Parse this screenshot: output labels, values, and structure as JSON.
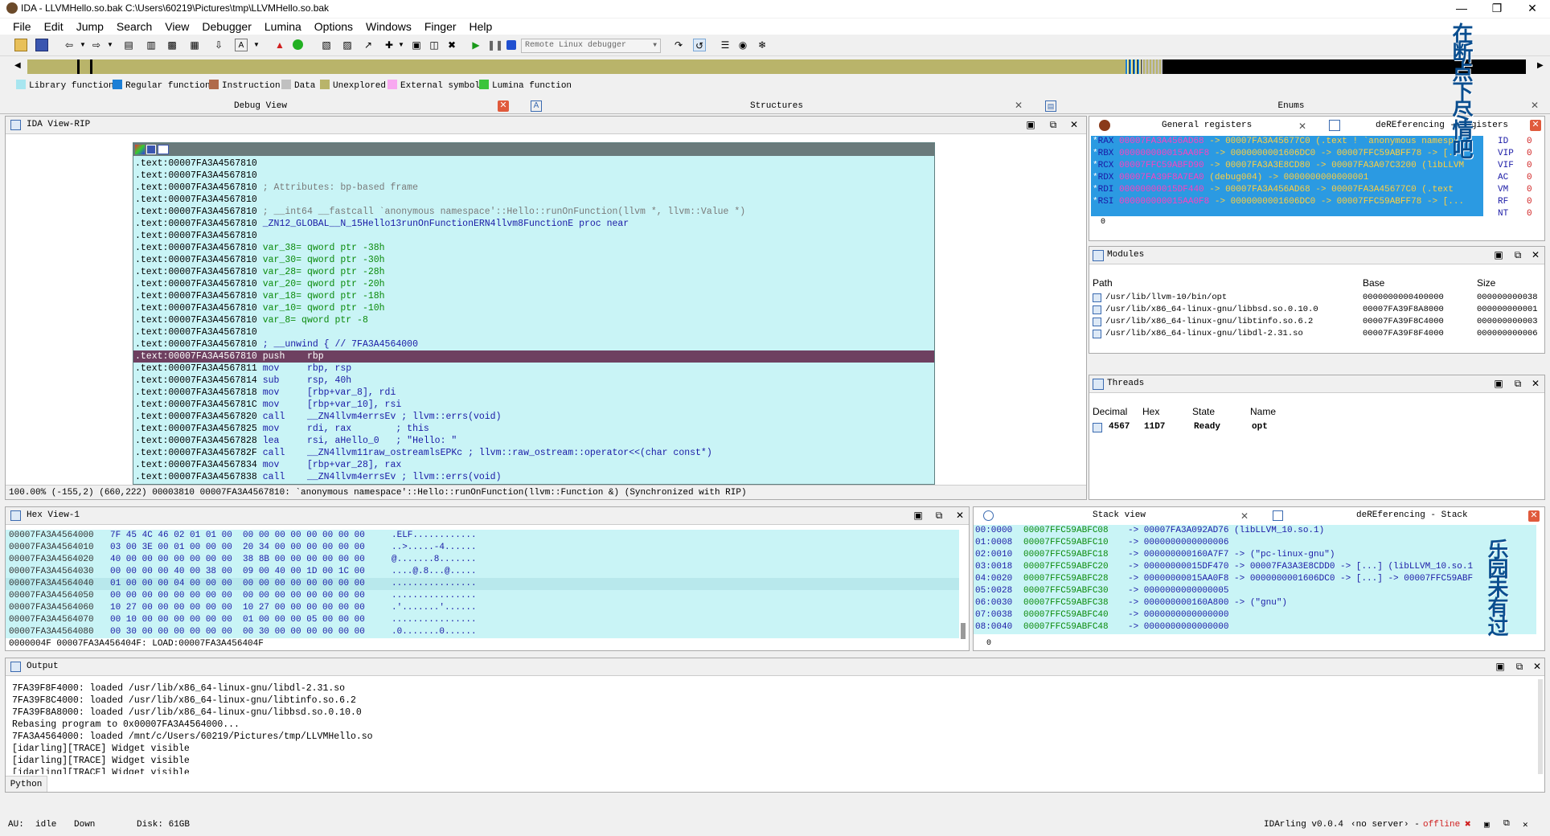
{
  "title": "IDA - LLVMHello.so.bak C:\\Users\\60219\\Pictures\\tmp\\LLVMHello.so.bak",
  "menu": [
    "File",
    "Edit",
    "Jump",
    "Search",
    "View",
    "Debugger",
    "Lumina",
    "Options",
    "Windows",
    "Finger",
    "Help"
  ],
  "debugger_select": "Remote Linux debugger",
  "legend": [
    {
      "label": "Library function",
      "color": "#a8e6f0"
    },
    {
      "label": "Regular function",
      "color": "#1c7fd6"
    },
    {
      "label": "Instruction",
      "color": "#b06a4a"
    },
    {
      "label": "Data",
      "color": "#c0c0c0"
    },
    {
      "label": "Unexplored",
      "color": "#b9b46a"
    },
    {
      "label": "External symbol",
      "color": "#f8a8f0"
    },
    {
      "label": "Lumina function",
      "color": "#3cc43c"
    }
  ],
  "tabs": {
    "debug_view": "Debug View",
    "structures": "Structures",
    "enums": "Enums"
  },
  "ida_view": {
    "title": "IDA View-RIP",
    "lines": [
      {
        "addr": ".text:00007FA3A4567810",
        "txt": ""
      },
      {
        "addr": ".text:00007FA3A4567810",
        "txt": ""
      },
      {
        "addr": ".text:00007FA3A4567810",
        "txt": "; Attributes: bp-based frame",
        "cls": "gry"
      },
      {
        "addr": ".text:00007FA3A4567810",
        "txt": ""
      },
      {
        "addr": ".text:00007FA3A4567810",
        "txt": "; __int64 __fastcall `anonymous namespace'::Hello::runOnFunction(llvm *, llvm::Value *)",
        "cls": "gry"
      },
      {
        "addr": ".text:00007FA3A4567810",
        "txt": "_ZN12_GLOBAL__N_15Hello13runOnFunctionERN4llvm8FunctionE proc near",
        "cls": "blu"
      },
      {
        "addr": ".text:00007FA3A4567810",
        "txt": ""
      },
      {
        "addr": ".text:00007FA3A4567810",
        "txt": "var_38= qword ptr -38h",
        "cls": "grn"
      },
      {
        "addr": ".text:00007FA3A4567810",
        "txt": "var_30= qword ptr -30h",
        "cls": "grn"
      },
      {
        "addr": ".text:00007FA3A4567810",
        "txt": "var_28= qword ptr -28h",
        "cls": "grn"
      },
      {
        "addr": ".text:00007FA3A4567810",
        "txt": "var_20= qword ptr -20h",
        "cls": "grn"
      },
      {
        "addr": ".text:00007FA3A4567810",
        "txt": "var_18= qword ptr -18h",
        "cls": "grn"
      },
      {
        "addr": ".text:00007FA3A4567810",
        "txt": "var_10= qword ptr -10h",
        "cls": "grn"
      },
      {
        "addr": ".text:00007FA3A4567810",
        "txt": "var_8= qword ptr -8",
        "cls": "grn"
      },
      {
        "addr": ".text:00007FA3A4567810",
        "txt": ""
      },
      {
        "addr": ".text:00007FA3A4567810",
        "txt": "; __unwind { // 7FA3A4564000",
        "cls": "blu"
      },
      {
        "addr": ".text:00007FA3A4567810",
        "txt": "push    rbp",
        "hl": true
      },
      {
        "addr": ".text:00007FA3A4567811",
        "txt": "mov     rbp, rsp",
        "cls": "blu"
      },
      {
        "addr": ".text:00007FA3A4567814",
        "txt": "sub     rsp, 40h",
        "cls": "blu"
      },
      {
        "addr": ".text:00007FA3A4567818",
        "txt": "mov     [rbp+var_8], rdi",
        "cls": "blu"
      },
      {
        "addr": ".text:00007FA3A456781C",
        "txt": "mov     [rbp+var_10], rsi",
        "cls": "blu"
      },
      {
        "addr": ".text:00007FA3A4567820",
        "txt": "call    __ZN4llvm4errsEv ; llvm::errs(void)",
        "cls": "blu"
      },
      {
        "addr": ".text:00007FA3A4567825",
        "txt": "mov     rdi, rax        ; this",
        "cls": "blu"
      },
      {
        "addr": ".text:00007FA3A4567828",
        "txt": "lea     rsi, aHello_0   ; \"Hello: \"",
        "cls": "blu"
      },
      {
        "addr": ".text:00007FA3A456782F",
        "txt": "call    __ZN4llvm11raw_ostreamlsEPKc ; llvm::raw_ostream::operator<<(char const*)",
        "cls": "blu"
      },
      {
        "addr": ".text:00007FA3A4567834",
        "txt": "mov     [rbp+var_28], rax",
        "cls": "blu"
      },
      {
        "addr": ".text:00007FA3A4567838",
        "txt": "call    __ZN4llvm4errsEv ; llvm::errs(void)",
        "cls": "blu"
      }
    ],
    "status": "100.00% (-155,2) (660,222) 00003810 00007FA3A4567810: `anonymous namespace'::Hello::runOnFunction(llvm::Function &) (Synchronized with RIP)"
  },
  "gen_regs": {
    "title": "General registers",
    "title2": "deREferencing - Registers",
    "rows": [
      {
        "name": "RAX",
        "val": "00007FA3A456AD68",
        "arrow": "-> 00007FA3A45677C0 (.text ! `anonymous namespa"
      },
      {
        "name": "RBX",
        "val": "000000000015AA0F8",
        "arrow": "-> 0000000001606DC0 -> 00007FFC59ABFF78 -> [..."
      },
      {
        "name": "RCX",
        "val": "00007FFC59ABFD90",
        "arrow": "-> 00007FA3A3E8CD80 -> 00007FA3A07C3200 (libLLVM"
      },
      {
        "name": "RDX",
        "val": "00007FA39F8A7EA0",
        "arrow": "(debug004) -> 0000000000000001"
      },
      {
        "name": "RDI",
        "val": "00000000015DF440",
        "arrow": "-> 00007FA3A456AD68 -> 00007FA3A45677C0 (.text"
      },
      {
        "name": "RSI",
        "val": "000000000015AA0F8",
        "arrow": "-> 0000000001606DC0 -> 00007FFC59ABFF78 -> [..."
      }
    ],
    "flags": [
      {
        "n": "ID",
        "v": "0"
      },
      {
        "n": "VIP",
        "v": "0"
      },
      {
        "n": "VIF",
        "v": "0"
      },
      {
        "n": "AC",
        "v": "0"
      },
      {
        "n": "VM",
        "v": "0"
      },
      {
        "n": "RF",
        "v": "0"
      },
      {
        "n": "NT",
        "v": "0"
      }
    ],
    "bottom": "0"
  },
  "modules": {
    "title": "Modules",
    "cols": [
      "Path",
      "Base",
      "Size"
    ],
    "rows": [
      {
        "path": "/usr/lib/llvm-10/bin/opt",
        "base": "0000000000400000",
        "size": "000000000038"
      },
      {
        "path": "/usr/lib/x86_64-linux-gnu/libbsd.so.0.10.0",
        "base": "00007FA39F8A8000",
        "size": "000000000001"
      },
      {
        "path": "/usr/lib/x86_64-linux-gnu/libtinfo.so.6.2",
        "base": "00007FA39F8C4000",
        "size": "000000000003"
      },
      {
        "path": "/usr/lib/x86_64-linux-gnu/libdl-2.31.so",
        "base": "00007FA39F8F4000",
        "size": "000000000006"
      }
    ]
  },
  "threads": {
    "title": "Threads",
    "cols": [
      "Decimal",
      "Hex",
      "State",
      "Name"
    ],
    "rows": [
      {
        "dec": "4567",
        "hex": "11D7",
        "state": "Ready",
        "name": "opt"
      }
    ]
  },
  "hex_view": {
    "title": "Hex View-1",
    "rows": [
      {
        "a": "00007FA3A4564000",
        "h": "7F 45 4C 46 02 01 01 00  00 00 00 00 00 00 00 00",
        "s": ".ELF............"
      },
      {
        "a": "00007FA3A4564010",
        "h": "03 00 3E 00 01 00 00 00  20 34 00 00 00 00 00 00",
        "s": "..>.....-4......"
      },
      {
        "a": "00007FA3A4564020",
        "h": "40 00 00 00 00 00 00 00  38 8B 00 00 00 00 00 00",
        "s": "@.......8......."
      },
      {
        "a": "00007FA3A4564030",
        "h": "00 00 00 00 40 00 38 00  09 00 40 00 1D 00 1C 00",
        "s": "....@.8...@....."
      },
      {
        "a": "00007FA3A4564040",
        "h": "01 00 00 00 04 00 00 00  00 00 00 00 00 00 00 00",
        "s": "................"
      },
      {
        "a": "00007FA3A4564050",
        "h": "00 00 00 00 00 00 00 00  00 00 00 00 00 00 00 00",
        "s": "................"
      },
      {
        "a": "00007FA3A4564060",
        "h": "10 27 00 00 00 00 00 00  10 27 00 00 00 00 00 00",
        "s": ".'.......'......"
      },
      {
        "a": "00007FA3A4564070",
        "h": "00 10 00 00 00 00 00 00  01 00 00 00 05 00 00 00",
        "s": "................"
      },
      {
        "a": "00007FA3A4564080",
        "h": "00 30 00 00 00 00 00 00  00 30 00 00 00 00 00 00",
        "s": ".0.......0......"
      }
    ],
    "status": "0000004F 00007FA3A456404F: LOAD:00007FA3A456404F"
  },
  "stack": {
    "title": "Stack view",
    "title2": "deREferencing - Stack",
    "rows": [
      {
        "off": "00:0000",
        "addr": "00007FFC59ABFC08",
        "val": "-> 00007FA3A092AD76 (libLLVM_10.so.1)"
      },
      {
        "off": "01:0008",
        "addr": "00007FFC59ABFC10",
        "val": "-> 0000000000000006"
      },
      {
        "off": "02:0010",
        "addr": "00007FFC59ABFC18",
        "val": "-> 000000000160A7F7 -> (\"pc-linux-gnu\")"
      },
      {
        "off": "03:0018",
        "addr": "00007FFC59ABFC20",
        "val": "-> 00000000015DF470 -> 00007FA3A3E8CDD0 -> [...] (libLLVM_10.so.1"
      },
      {
        "off": "04:0020",
        "addr": "00007FFC59ABFC28",
        "val": "-> 00000000015AA0F8 -> 0000000001606DC0 -> [...] -> 00007FFC59ABF"
      },
      {
        "off": "05:0028",
        "addr": "00007FFC59ABFC30",
        "val": "-> 0000000000000005"
      },
      {
        "off": "06:0030",
        "addr": "00007FFC59ABFC38",
        "val": "-> 000000000160A800 -> (\"gnu\")"
      },
      {
        "off": "07:0038",
        "addr": "00007FFC59ABFC40",
        "val": "-> 0000000000000000"
      },
      {
        "off": "08:0040",
        "addr": "00007FFC59ABFC48",
        "val": "-> 0000000000000000"
      }
    ],
    "bottom": "0"
  },
  "output": {
    "title": "Output",
    "lines": [
      "7FA39F8F4000: loaded /usr/lib/x86_64-linux-gnu/libdl-2.31.so",
      "7FA39F8C4000: loaded /usr/lib/x86_64-linux-gnu/libtinfo.so.6.2",
      "7FA39F8A8000: loaded /usr/lib/x86_64-linux-gnu/libbsd.so.0.10.0",
      "Rebasing program to 0x00007FA3A4564000...",
      "7FA3A4564000: loaded /mnt/c/Users/60219/Pictures/tmp/LLVMHello.so",
      "[idarling][TRACE] Widget visible",
      "[idarling][TRACE] Widget visible",
      "[idarling][TRACE] Widget visible",
      "[idarling][TRACE] Widget visible"
    ]
  },
  "python_label": "Python",
  "statusbar": {
    "au": "AU:",
    "state": "idle",
    "dir": "Down",
    "disk": "Disk: 61GB",
    "idarling": "IDArling v0.0.4",
    "server": "‹no server› -",
    "offline": "offline"
  },
  "overlay": {
    "top": "在断点下尽情吧",
    "bottom": "乐园未有过"
  }
}
